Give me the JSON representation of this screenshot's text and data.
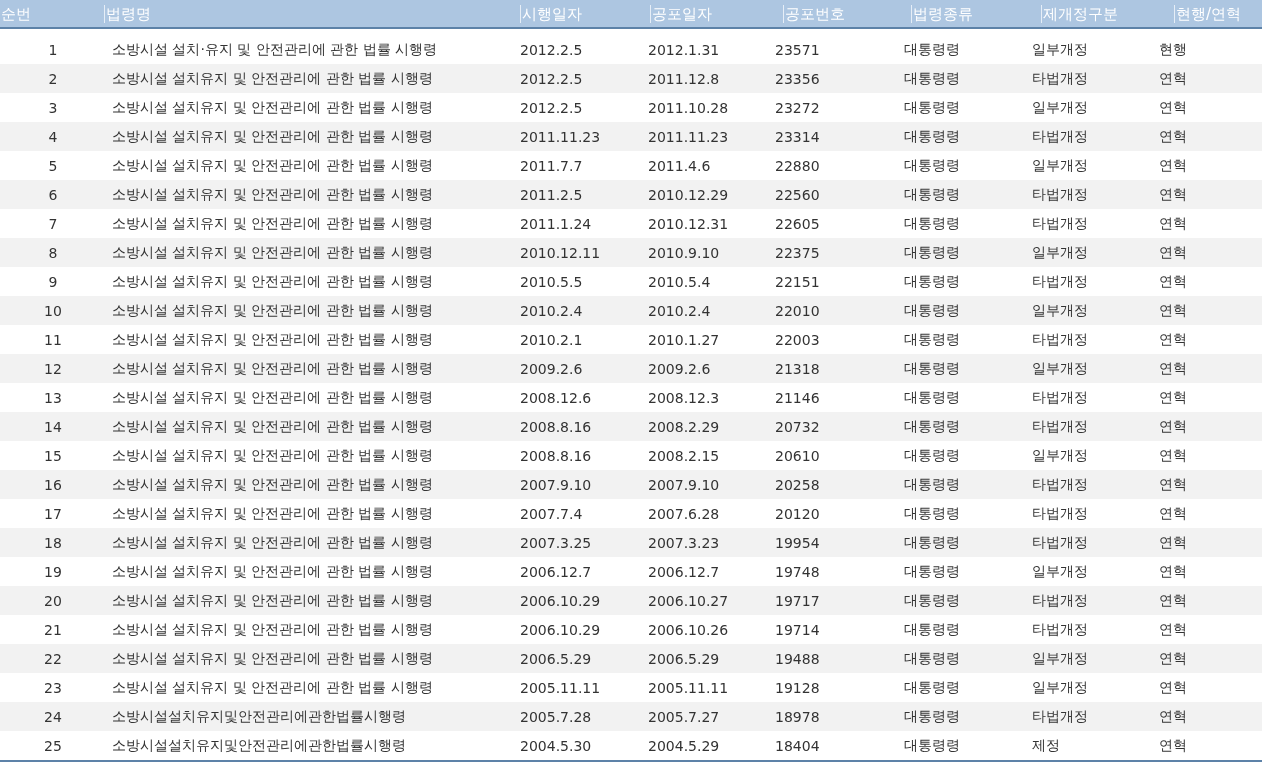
{
  "table": {
    "columns": [
      "순번",
      "법령명",
      "시행일자",
      "공포일자",
      "공포번호",
      "법령종류",
      "제개정구분",
      "현행/연혁"
    ],
    "rows": [
      [
        "1",
        "소방시설 설치·유지 및 안전관리에 관한 법률 시행령",
        "2012.2.5",
        "2012.1.31",
        "23571",
        "대통령령",
        "일부개정",
        "현행"
      ],
      [
        "2",
        "소방시설 설치유지 및 안전관리에 관한 법률 시행령",
        "2012.2.5",
        "2011.12.8",
        "23356",
        "대통령령",
        "타법개정",
        "연혁"
      ],
      [
        "3",
        "소방시설 설치유지 및 안전관리에 관한 법률 시행령",
        "2012.2.5",
        "2011.10.28",
        "23272",
        "대통령령",
        "일부개정",
        "연혁"
      ],
      [
        "4",
        "소방시설 설치유지 및 안전관리에 관한 법률 시행령",
        "2011.11.23",
        "2011.11.23",
        "23314",
        "대통령령",
        "타법개정",
        "연혁"
      ],
      [
        "5",
        "소방시설 설치유지 및 안전관리에 관한 법률 시행령",
        "2011.7.7",
        "2011.4.6",
        "22880",
        "대통령령",
        "일부개정",
        "연혁"
      ],
      [
        "6",
        "소방시설 설치유지 및 안전관리에 관한 법률 시행령",
        "2011.2.5",
        "2010.12.29",
        "22560",
        "대통령령",
        "타법개정",
        "연혁"
      ],
      [
        "7",
        "소방시설 설치유지 및 안전관리에 관한 법률 시행령",
        "2011.1.24",
        "2010.12.31",
        "22605",
        "대통령령",
        "타법개정",
        "연혁"
      ],
      [
        "8",
        "소방시설 설치유지 및 안전관리에 관한 법률 시행령",
        "2010.12.11",
        "2010.9.10",
        "22375",
        "대통령령",
        "일부개정",
        "연혁"
      ],
      [
        "9",
        "소방시설 설치유지 및 안전관리에 관한 법률 시행령",
        "2010.5.5",
        "2010.5.4",
        "22151",
        "대통령령",
        "타법개정",
        "연혁"
      ],
      [
        "10",
        "소방시설 설치유지 및 안전관리에 관한 법률 시행령",
        "2010.2.4",
        "2010.2.4",
        "22010",
        "대통령령",
        "일부개정",
        "연혁"
      ],
      [
        "11",
        "소방시설 설치유지 및 안전관리에 관한 법률 시행령",
        "2010.2.1",
        "2010.1.27",
        "22003",
        "대통령령",
        "타법개정",
        "연혁"
      ],
      [
        "12",
        "소방시설 설치유지 및 안전관리에 관한 법률 시행령",
        "2009.2.6",
        "2009.2.6",
        "21318",
        "대통령령",
        "일부개정",
        "연혁"
      ],
      [
        "13",
        "소방시설 설치유지 및 안전관리에 관한 법률 시행령",
        "2008.12.6",
        "2008.12.3",
        "21146",
        "대통령령",
        "타법개정",
        "연혁"
      ],
      [
        "14",
        "소방시설 설치유지 및 안전관리에 관한 법률 시행령",
        "2008.8.16",
        "2008.2.29",
        "20732",
        "대통령령",
        "타법개정",
        "연혁"
      ],
      [
        "15",
        "소방시설 설치유지 및 안전관리에 관한 법률 시행령",
        "2008.8.16",
        "2008.2.15",
        "20610",
        "대통령령",
        "일부개정",
        "연혁"
      ],
      [
        "16",
        "소방시설 설치유지 및 안전관리에 관한 법률 시행령",
        "2007.9.10",
        "2007.9.10",
        "20258",
        "대통령령",
        "타법개정",
        "연혁"
      ],
      [
        "17",
        "소방시설 설치유지 및 안전관리에 관한 법률 시행령",
        "2007.7.4",
        "2007.6.28",
        "20120",
        "대통령령",
        "타법개정",
        "연혁"
      ],
      [
        "18",
        "소방시설 설치유지 및 안전관리에 관한 법률 시행령",
        "2007.3.25",
        "2007.3.23",
        "19954",
        "대통령령",
        "타법개정",
        "연혁"
      ],
      [
        "19",
        "소방시설 설치유지 및 안전관리에 관한 법률 시행령",
        "2006.12.7",
        "2006.12.7",
        "19748",
        "대통령령",
        "일부개정",
        "연혁"
      ],
      [
        "20",
        "소방시설 설치유지 및 안전관리에 관한 법률 시행령",
        "2006.10.29",
        "2006.10.27",
        "19717",
        "대통령령",
        "타법개정",
        "연혁"
      ],
      [
        "21",
        "소방시설 설치유지 및 안전관리에 관한 법률 시행령",
        "2006.10.29",
        "2006.10.26",
        "19714",
        "대통령령",
        "타법개정",
        "연혁"
      ],
      [
        "22",
        "소방시설 설치유지 및 안전관리에 관한 법률 시행령",
        "2006.5.29",
        "2006.5.29",
        "19488",
        "대통령령",
        "일부개정",
        "연혁"
      ],
      [
        "23",
        "소방시설 설치유지 및 안전관리에 관한 법률 시행령",
        "2005.11.11",
        "2005.11.11",
        "19128",
        "대통령령",
        "일부개정",
        "연혁"
      ],
      [
        "24",
        "소방시설설치유지및안전관리에관한법률시행령",
        "2005.7.28",
        "2005.7.27",
        "18978",
        "대통령령",
        "타법개정",
        "연혁"
      ],
      [
        "25",
        "소방시설설치유지및안전관리에관한법률시행령",
        "2004.5.30",
        "2004.5.29",
        "18404",
        "대통령령",
        "제정",
        "연혁"
      ]
    ]
  }
}
